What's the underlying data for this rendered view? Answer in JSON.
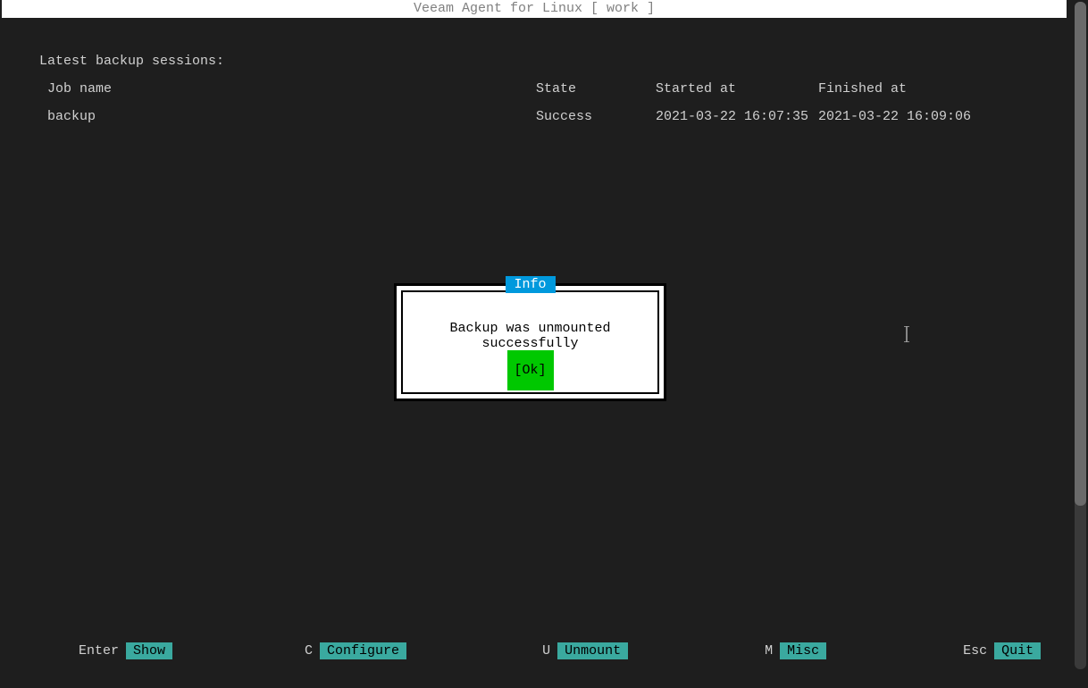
{
  "titlebar": {
    "text": "Veeam Agent for Linux   [ work ]"
  },
  "section_heading": "Latest backup sessions:",
  "table": {
    "headers": {
      "jobname": "Job name",
      "state": "State",
      "started": "Started at",
      "finished": "Finished at"
    },
    "rows": [
      {
        "jobname": "backup",
        "state": "Success",
        "started": "2021-03-22 16:07:35",
        "finished": "2021-03-22 16:09:06"
      }
    ]
  },
  "dialog": {
    "title": "Info",
    "message": "Backup was unmounted successfully",
    "button": "[Ok]"
  },
  "commands": {
    "enter": {
      "key": "Enter",
      "label": "Show"
    },
    "c": {
      "key": "C",
      "label": "Configure"
    },
    "u": {
      "key": "U",
      "label": "Unmount"
    },
    "m": {
      "key": "M",
      "label": "Misc"
    },
    "esc": {
      "key": "Esc",
      "label": "Quit"
    }
  }
}
